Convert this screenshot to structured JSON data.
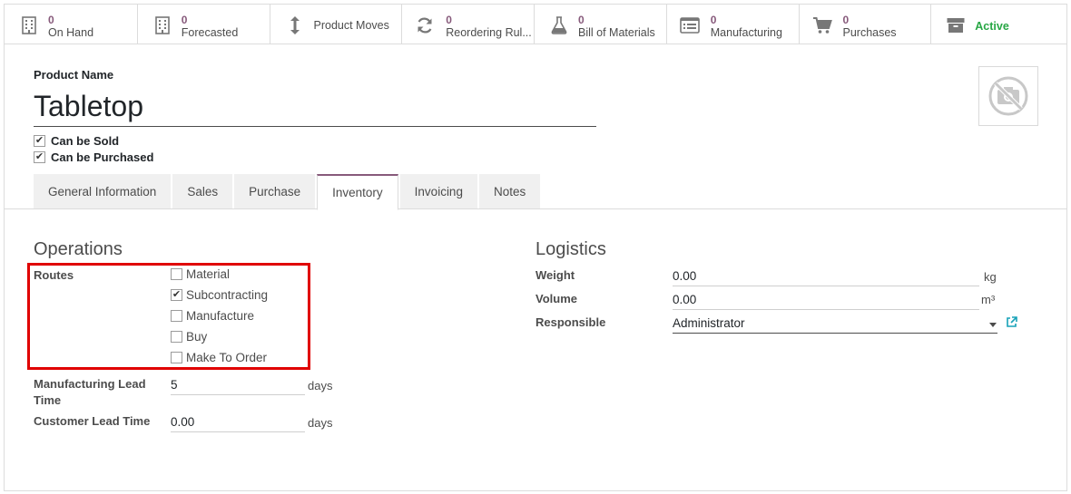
{
  "smart_buttons": [
    {
      "count": "0",
      "label": "On Hand",
      "icon": "building-icon"
    },
    {
      "count": "0",
      "label": "Forecasted",
      "icon": "building-icon"
    },
    {
      "count": "",
      "label": "Product Moves",
      "icon": "arrows-vertical-icon"
    },
    {
      "count": "0",
      "label": "Reordering Rul...",
      "icon": "refresh-icon"
    },
    {
      "count": "0",
      "label": "Bill of Materials",
      "icon": "flask-icon"
    },
    {
      "count": "0",
      "label": "Manufacturing",
      "icon": "list-alt-icon"
    },
    {
      "count": "0",
      "label": "Purchases",
      "icon": "shopping-cart-icon"
    },
    {
      "count": "",
      "label": "Active",
      "icon": "archive-icon"
    }
  ],
  "header": {
    "product_name_label": "Product Name",
    "product_name": "Tabletop",
    "can_be_sold_label": "Can be Sold",
    "can_be_sold": true,
    "can_be_purchased_label": "Can be Purchased",
    "can_be_purchased": true
  },
  "tabs": [
    {
      "label": "General Information",
      "active": false
    },
    {
      "label": "Sales",
      "active": false
    },
    {
      "label": "Purchase",
      "active": false
    },
    {
      "label": "Inventory",
      "active": true
    },
    {
      "label": "Invoicing",
      "active": false
    },
    {
      "label": "Notes",
      "active": false
    }
  ],
  "operations": {
    "title": "Operations",
    "routes_label": "Routes",
    "routes": [
      {
        "label": "Material",
        "checked": false
      },
      {
        "label": "Subcontracting",
        "checked": true
      },
      {
        "label": "Manufacture",
        "checked": false
      },
      {
        "label": "Buy",
        "checked": false
      },
      {
        "label": "Make To Order",
        "checked": false
      }
    ],
    "manufacturing_lead_time_label": "Manufacturing Lead Time",
    "manufacturing_lead_time": "5",
    "customer_lead_time_label": "Customer Lead Time",
    "customer_lead_time": "0.00",
    "days_unit": "days"
  },
  "logistics": {
    "title": "Logistics",
    "weight_label": "Weight",
    "weight": "0.00",
    "weight_unit": "kg",
    "volume_label": "Volume",
    "volume": "0.00",
    "volume_unit": "m³",
    "responsible_label": "Responsible",
    "responsible": "Administrator"
  },
  "colors": {
    "accent": "#875a7b",
    "active_green": "#28a745",
    "highlight_red": "#e00000"
  }
}
